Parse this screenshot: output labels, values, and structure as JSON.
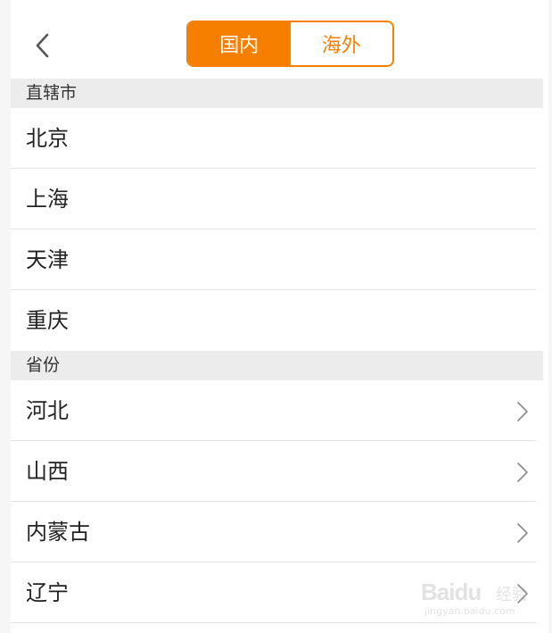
{
  "header": {
    "back_icon": "chevron-left-icon",
    "tabs": [
      {
        "label": "国内",
        "active": true
      },
      {
        "label": "海外",
        "active": false
      }
    ],
    "accent_color": "#f77f00"
  },
  "sections": [
    {
      "title": "直辖市",
      "items": [
        {
          "label": "北京",
          "has_arrow": false
        },
        {
          "label": "上海",
          "has_arrow": false
        },
        {
          "label": "天津",
          "has_arrow": false
        },
        {
          "label": "重庆",
          "has_arrow": false
        }
      ]
    },
    {
      "title": "省份",
      "items": [
        {
          "label": "河北",
          "has_arrow": true
        },
        {
          "label": "山西",
          "has_arrow": true
        },
        {
          "label": "内蒙古",
          "has_arrow": true
        },
        {
          "label": "辽宁",
          "has_arrow": true
        }
      ]
    }
  ],
  "watermark": {
    "brand": "Baidu",
    "suffix": "经验",
    "url": "jingyan.baidu.com"
  }
}
